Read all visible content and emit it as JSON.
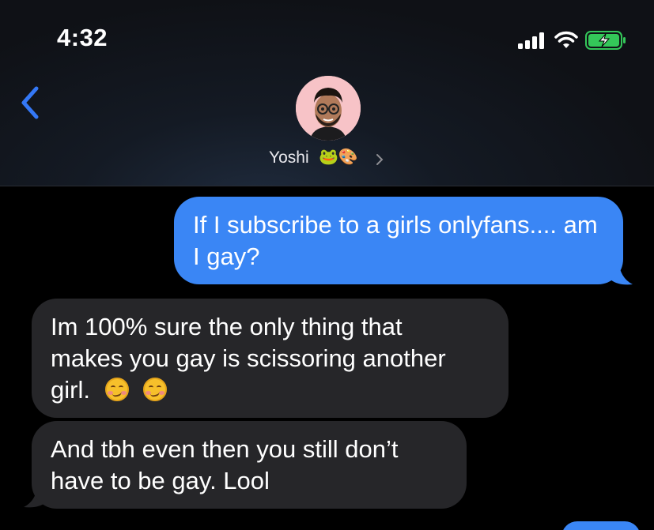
{
  "status_bar": {
    "time": "4:32"
  },
  "contact": {
    "name": "Yoshi",
    "emoji": "🐸🎨"
  },
  "messages": [
    {
      "direction": "outgoing",
      "text": "If I subscribe to a girls onlyfans.... am I gay?"
    },
    {
      "direction": "incoming",
      "line1": "Im 100% sure the only thing that",
      "line2": "makes you gay is scissoring another",
      "line3": "girl.",
      "emoji": "🥴🥴"
    },
    {
      "direction": "incoming",
      "text": "And tbh even then you still don’t have to be gay. Lool"
    }
  ],
  "colors": {
    "outgoing": "#3a86f5",
    "incoming": "#262629",
    "accent": "#3478f6"
  },
  "icons": [
    "signal-icon",
    "wifi-icon",
    "battery-charging-icon",
    "back-chevron-icon",
    "chevron-right-icon"
  ]
}
